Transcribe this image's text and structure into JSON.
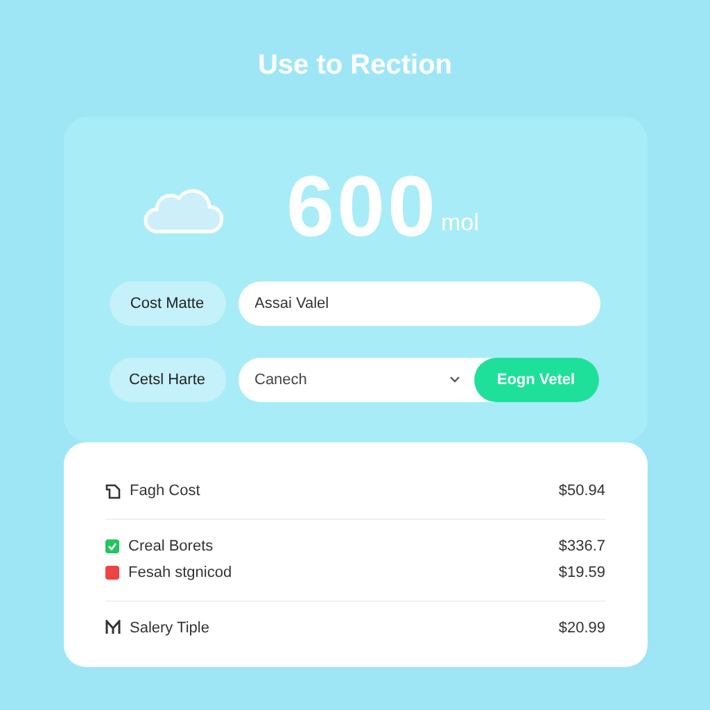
{
  "title": "Use to Rection",
  "reading": {
    "value": "600",
    "unit": "mol"
  },
  "fields": [
    {
      "kind": "text",
      "label": "Cost Matte",
      "value": "Assai Valel"
    },
    {
      "kind": "select",
      "label": "Cetsl Harte",
      "value": "Canech",
      "button": "Eogn Vetel"
    }
  ],
  "sections": [
    [
      {
        "kind": "icon",
        "label": "Fagh Cost",
        "amount": "$50.94"
      }
    ],
    [
      {
        "kind": "swatch",
        "label": "Creal Borets",
        "amount": "$336.7",
        "color": "#22c55e",
        "checked": true
      },
      {
        "kind": "swatch",
        "label": "Fesah stgnicod",
        "amount": "$19.59",
        "color": "#ef4444",
        "checked": false
      }
    ],
    [
      {
        "kind": "glyph",
        "label": "Salery Tiple",
        "amount": "$20.99"
      }
    ]
  ]
}
